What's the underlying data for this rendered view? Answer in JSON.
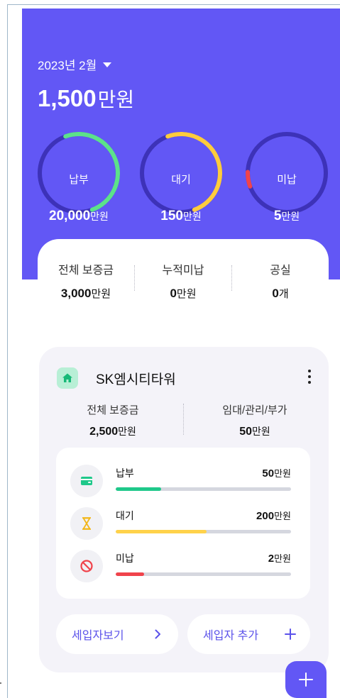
{
  "header": {
    "month": "2023년 2월",
    "total_amount": "1,500",
    "total_unit": "만원"
  },
  "gauges": [
    {
      "label": "납부",
      "value": "20,000",
      "unit": "만원",
      "progress": 0.5,
      "color": "#5ce28a"
    },
    {
      "label": "대기",
      "value": "150",
      "unit": "만원",
      "progress": 0.5,
      "color": "#ffcc3d"
    },
    {
      "label": "미납",
      "value": "5",
      "unit": "만원",
      "progress": 0.06,
      "color": "#f0434b"
    }
  ],
  "summary": [
    {
      "label": "전체 보증금",
      "value": "3,000",
      "unit": "만원"
    },
    {
      "label": "누적미납",
      "value": "0",
      "unit": "만원"
    },
    {
      "label": "공실",
      "value": "0",
      "unit": "개"
    }
  ],
  "building": {
    "icon": "home-icon",
    "name": "SK엠시티타워",
    "deposit_label": "전체 보증금",
    "deposit_value": "2,500",
    "deposit_unit": "만원",
    "fee_label": "임대/관리/부가",
    "fee_value": "50",
    "fee_unit": "만원",
    "rows": [
      {
        "label": "납부",
        "value": "50",
        "unit": "만원",
        "progress": 0.26,
        "color": "#1fc88a",
        "icon": "wallet-icon"
      },
      {
        "label": "대기",
        "value": "200",
        "unit": "만원",
        "progress": 0.52,
        "color": "#ffd24a",
        "icon": "hourglass-icon"
      },
      {
        "label": "미납",
        "value": "2",
        "unit": "만원",
        "progress": 0.16,
        "color": "#f0434b",
        "icon": "prohibited-icon"
      }
    ],
    "view_tenants_label": "세입자보기",
    "add_tenant_label": "세입자 추가"
  },
  "colors": {
    "accent": "#6257f5",
    "track": "#3d32b8"
  }
}
